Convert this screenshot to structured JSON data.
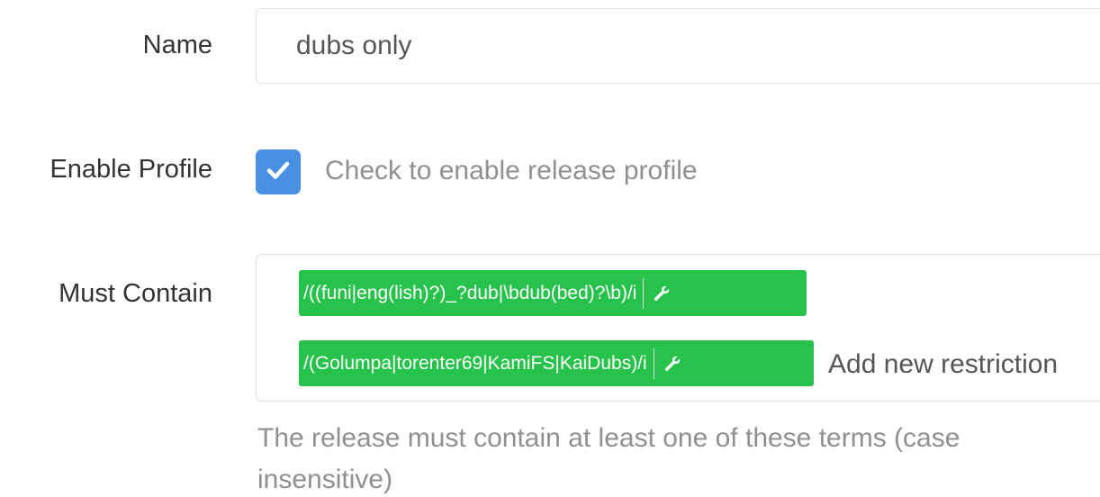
{
  "form": {
    "name_label": "Name",
    "name_value": "dubs only",
    "enable_label": "Enable Profile",
    "enable_checked": true,
    "enable_help": "Check to enable release profile",
    "must_contain_label": "Must Contain",
    "must_contain_tags": [
      "/((funi|eng(lish)?)_?dub|\\bdub(bed)?\\b)/i",
      "/(Golumpa|torenter69|KamiFS|KaiDubs)/i"
    ],
    "must_contain_placeholder": "Add new restriction",
    "must_contain_help": "The release must contain at least one of these terms (case insensitive)"
  },
  "colors": {
    "checkbox": "#4a90e2",
    "tag_green": "#27c24c"
  },
  "icons": {
    "check": "check-icon",
    "tag_edit": "wrench-icon"
  }
}
